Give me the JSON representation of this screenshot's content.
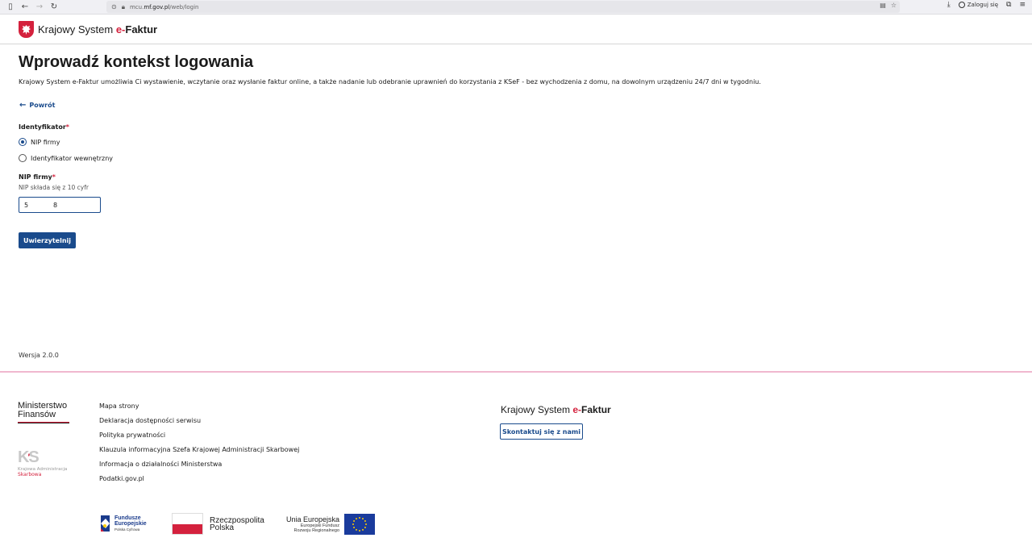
{
  "browser": {
    "url_prefix": "mcu.",
    "url_domain": "mf.gov.pl",
    "url_path": "/web/login",
    "login_label": "Zaloguj się"
  },
  "header": {
    "brand_prefix": "Krajowy System ",
    "brand_e": "e-",
    "brand_faktur": "Faktur"
  },
  "main": {
    "title": "Wprowadź kontekst logowania",
    "intro": "Krajowy System e-Faktur umożliwia Ci wystawienie, wczytanie oraz wysłanie faktur online, a także nadanie lub odebranie uprawnień do korzystania z KSeF - bez wychodzenia z domu, na dowolnym urządzeniu 24/7 dni w tygodniu.",
    "back_label": "Powrót",
    "identifier_label": "Identyfikator",
    "required_mark": "*",
    "radio_options": [
      "NIP firmy",
      "Identyfikator wewnętrzny"
    ],
    "selected_option": "NIP firmy",
    "nip_label": "NIP firmy",
    "nip_hint": "NIP składa się z 10 cyfr",
    "nip_value": "5          8",
    "submit_label": "Uwierzytelnij",
    "version": "Wersja 2.0.0"
  },
  "footer": {
    "ministry_line1": "Ministerstwo",
    "ministry_line2": "Finansów",
    "kas_line1": "Krajowa Administracja",
    "kas_line2": "Skarbowa",
    "links": [
      "Mapa strony",
      "Deklaracja dostępności serwisu",
      "Polityka prywatności",
      "Klauzula informacyjna Szefa Krajowej Administracji Skarbowej",
      "Informacja o działalności Ministerstwa",
      "Podatki.gov.pl"
    ],
    "brand_prefix": "Krajowy System ",
    "brand_e": "e-",
    "brand_faktur": "Faktur",
    "contact_label": "Skontaktuj się z nami",
    "fe_line1": "Fundusze",
    "fe_line2": "Europejskie",
    "fe_line3": "Polska Cyfrowa",
    "rp_line1": "Rzeczpospolita",
    "rp_line2": "Polska",
    "ue_line1": "Unia Europejska",
    "ue_line2": "Europejski Fundusz",
    "ue_line3": "Rozwoju Regionalnego"
  },
  "colors": {
    "primary": "#1a4b8c",
    "accent_red": "#d4213d",
    "footer_divider": "#f0b8cf",
    "eu_blue": "#1a3b9c",
    "eu_star": "#ffcc00"
  }
}
